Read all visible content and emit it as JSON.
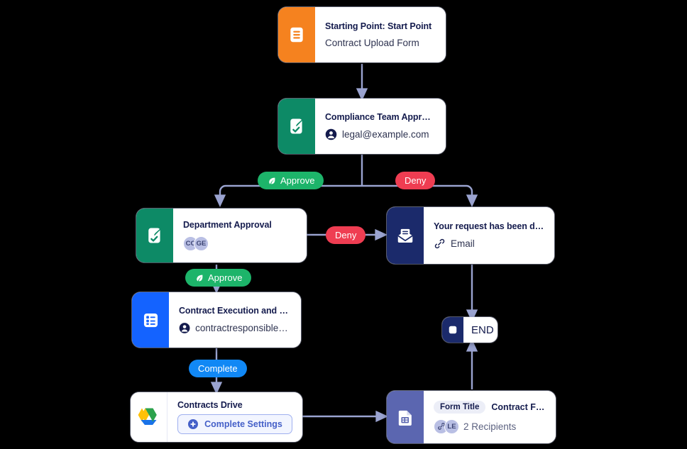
{
  "canvas": {
    "background": "#000000",
    "edge_color": "#9aa3d0"
  },
  "nodes": {
    "start": {
      "title": "Starting Point: Start Point",
      "subtitle": "Contract Upload Form",
      "icon": "document-lines-icon",
      "icon_color": "#f5821f"
    },
    "compliance": {
      "title": "Compliance Team Approval",
      "subtitle": "legal@example.com",
      "icon": "approval-document-icon",
      "sub_icon": "person-circle-icon",
      "icon_color": "#0d8a66"
    },
    "department": {
      "title": "Department Approval",
      "icon": "approval-document-icon",
      "icon_color": "#0d8a66",
      "avatars": [
        "CC",
        "GE"
      ]
    },
    "denied": {
      "title": "Your request has been denied.",
      "subtitle": "Email",
      "icon": "envelope-icon",
      "sub_icon": "link-paperclip-icon",
      "icon_color": "#1b2a6b"
    },
    "execution": {
      "title": "Contract Execution and Signi...",
      "subtitle": "contractresponsible@...",
      "icon": "checklist-form-icon",
      "sub_icon": "person-circle-icon",
      "icon_color": "#1463ff"
    },
    "drive": {
      "title": "Contracts Drive",
      "icon": "google-drive-icon",
      "icon_color": "#ffffff",
      "button_label": "Complete Settings",
      "button_icon": "plus-circle-icon"
    },
    "form": {
      "title_badge": "Form Title",
      "title_value": "Contract Flow ...",
      "recipients_label": "2 Recipients",
      "icon": "form-document-icon",
      "icon_color": "#5b66b0",
      "chips": [
        "link-paperclip-icon",
        "LE"
      ]
    },
    "end": {
      "label": "END",
      "icon": "stop-square-icon",
      "icon_color": "#1b2a6b"
    }
  },
  "edge_labels": {
    "compliance_approve": {
      "text": "Approve",
      "icon": "approve-leaf-icon",
      "color": "#1db46a"
    },
    "compliance_deny": {
      "text": "Deny",
      "color": "#ef3d52"
    },
    "department_approve": {
      "text": "Approve",
      "icon": "approve-leaf-icon",
      "color": "#1db46a"
    },
    "department_deny": {
      "text": "Deny",
      "color": "#ef3d52"
    },
    "execution_complete": {
      "text": "Complete",
      "color": "#1188f5"
    }
  }
}
